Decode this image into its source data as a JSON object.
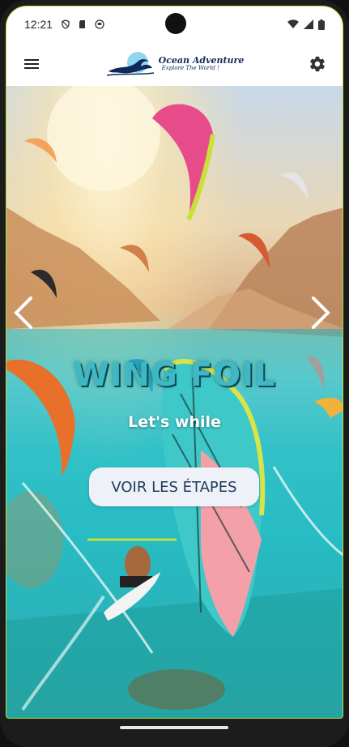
{
  "status_bar": {
    "time": "12:21",
    "left_icons": [
      "shield-icon",
      "sd-card-icon",
      "android-icon"
    ],
    "right_icons": [
      "wifi-icon",
      "signal-icon",
      "battery-icon"
    ]
  },
  "app_bar": {
    "brand_title": "Ocean Adventure",
    "brand_subtitle": "Explore The World !",
    "menu_icon": "hamburger-menu-icon",
    "settings_icon": "gear-icon"
  },
  "hero": {
    "title": "WING FOIL",
    "subtitle": "Let's while",
    "cta_label": "VOIR LES ÉTAPES",
    "prev_icon": "chevron-left-icon",
    "next_icon": "chevron-right-icon"
  },
  "colors": {
    "title": "#3fb8c4",
    "cta_bg": "#eef2f8",
    "cta_text": "#1f3a5c",
    "screen_border": "#b6e23a"
  }
}
